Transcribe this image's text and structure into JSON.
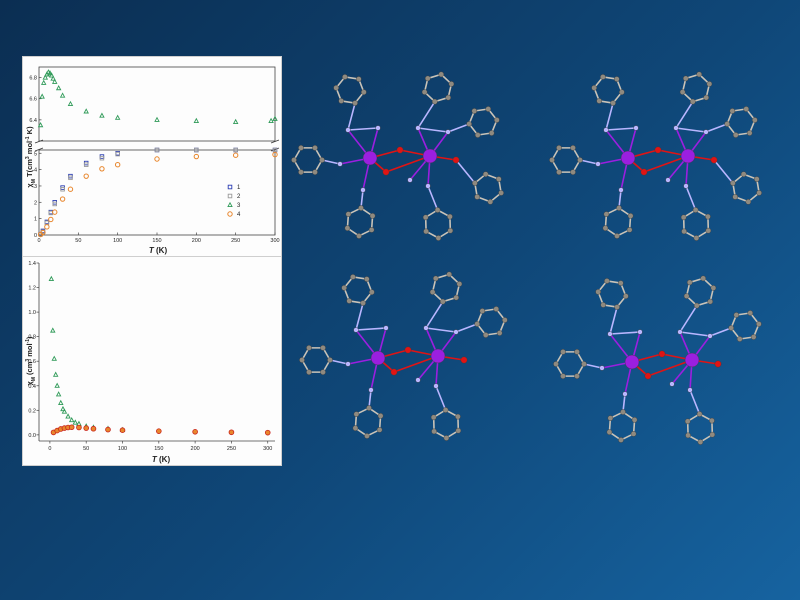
{
  "colors": {
    "series1": "#2d3fb4",
    "series2": "#9a9a9a",
    "series3": "#2f9a58",
    "series4": "#e8862c",
    "series4_edge": "#c9241c",
    "atom_metal": "#9b1fe0",
    "atom_nitrogen": "#b9b6ff",
    "atom_oxygen": "#e01414",
    "atom_carbon": "#8f8a80",
    "bond_carbon": "#c9c3b8"
  },
  "chart_data": [
    {
      "type": "scatter",
      "ylabel_pre": "χ",
      "ylabel_sub": "M",
      "ylabel_main": " T(cm",
      "ylabel_sup1": "3",
      "ylabel_mid": " mol",
      "ylabel_sup2": "-1",
      "ylabel_post": " K)",
      "xlabel": "T",
      "xlabel_unit": " (K)",
      "xlim": [
        0,
        300
      ],
      "x_ticks": [
        "0",
        "50",
        "100",
        "150",
        "200",
        "250",
        "300"
      ],
      "y_axis_break": true,
      "ylim_lower": [
        0,
        5.2
      ],
      "ylim_upper": [
        6.2,
        6.9
      ],
      "y_ticks_lower": [
        "0",
        "1",
        "2",
        "3",
        "4",
        "5"
      ],
      "y_ticks_upper": [
        "6.4",
        "6.6",
        "6.8"
      ],
      "legend": [
        "1",
        "2",
        "3",
        "4"
      ],
      "series": [
        {
          "name": "1",
          "x": [
            2,
            5,
            10,
            15,
            20,
            30,
            40,
            60,
            80,
            100,
            150,
            200,
            250,
            300
          ],
          "y": [
            0.05,
            0.25,
            0.8,
            1.4,
            2.0,
            2.9,
            3.6,
            4.4,
            4.8,
            5.0,
            5.25,
            5.35,
            5.42,
            5.45
          ]
        },
        {
          "name": "2",
          "x": [
            2,
            5,
            10,
            15,
            20,
            30,
            40,
            60,
            80,
            100,
            150,
            200,
            250,
            300
          ],
          "y": [
            0.05,
            0.2,
            0.75,
            1.35,
            1.9,
            2.8,
            3.5,
            4.3,
            4.7,
            4.95,
            5.2,
            5.3,
            5.38,
            5.42
          ]
        },
        {
          "name": "3",
          "x": [
            2,
            4,
            6,
            8,
            10,
            12,
            14,
            16,
            18,
            20,
            25,
            30,
            40,
            60,
            80,
            100,
            150,
            200,
            250,
            295,
            300
          ],
          "y": [
            6.35,
            6.62,
            6.75,
            6.8,
            6.83,
            6.85,
            6.84,
            6.82,
            6.79,
            6.76,
            6.7,
            6.63,
            6.55,
            6.48,
            6.44,
            6.42,
            6.4,
            6.39,
            6.38,
            6.39,
            6.41
          ]
        },
        {
          "name": "4",
          "x": [
            2,
            5,
            10,
            15,
            20,
            30,
            40,
            60,
            80,
            100,
            150,
            200,
            250,
            300
          ],
          "y": [
            0.03,
            0.15,
            0.5,
            0.95,
            1.4,
            2.2,
            2.8,
            3.6,
            4.05,
            4.3,
            4.65,
            4.8,
            4.88,
            4.92
          ]
        }
      ]
    },
    {
      "type": "scatter",
      "ylabel_pre": "χ",
      "ylabel_sub": "M",
      "ylabel_main": " (cm",
      "ylabel_sup1": "3",
      "ylabel_mid": " mol",
      "ylabel_sup2": "-1",
      "ylabel_post": ")",
      "xlabel": "T",
      "xlabel_unit": " (K)",
      "xlim": [
        -15,
        310
      ],
      "ylim": [
        -0.05,
        1.4
      ],
      "x_ticks": [
        "0",
        "50",
        "100",
        "150",
        "200",
        "250",
        "300"
      ],
      "y_ticks": [
        "0.0",
        "0.2",
        "0.4",
        "0.6",
        "0.8",
        "1.0",
        "1.2",
        "1.4"
      ],
      "series": [
        {
          "name": "3",
          "x": [
            2,
            4,
            6,
            8,
            10,
            12,
            15,
            18,
            20,
            25,
            30,
            35,
            40,
            50,
            60,
            80,
            100
          ],
          "y": [
            1.27,
            0.85,
            0.62,
            0.49,
            0.4,
            0.33,
            0.26,
            0.21,
            0.19,
            0.15,
            0.12,
            0.1,
            0.09,
            0.07,
            0.06,
            0.05,
            0.04
          ]
        },
        {
          "name": "4",
          "x": [
            5,
            10,
            15,
            20,
            25,
            30,
            40,
            50,
            60,
            80,
            100,
            150,
            200,
            250,
            300
          ],
          "y": [
            0.02,
            0.035,
            0.048,
            0.055,
            0.06,
            0.062,
            0.06,
            0.055,
            0.05,
            0.043,
            0.038,
            0.03,
            0.025,
            0.021,
            0.018
          ]
        }
      ]
    }
  ]
}
